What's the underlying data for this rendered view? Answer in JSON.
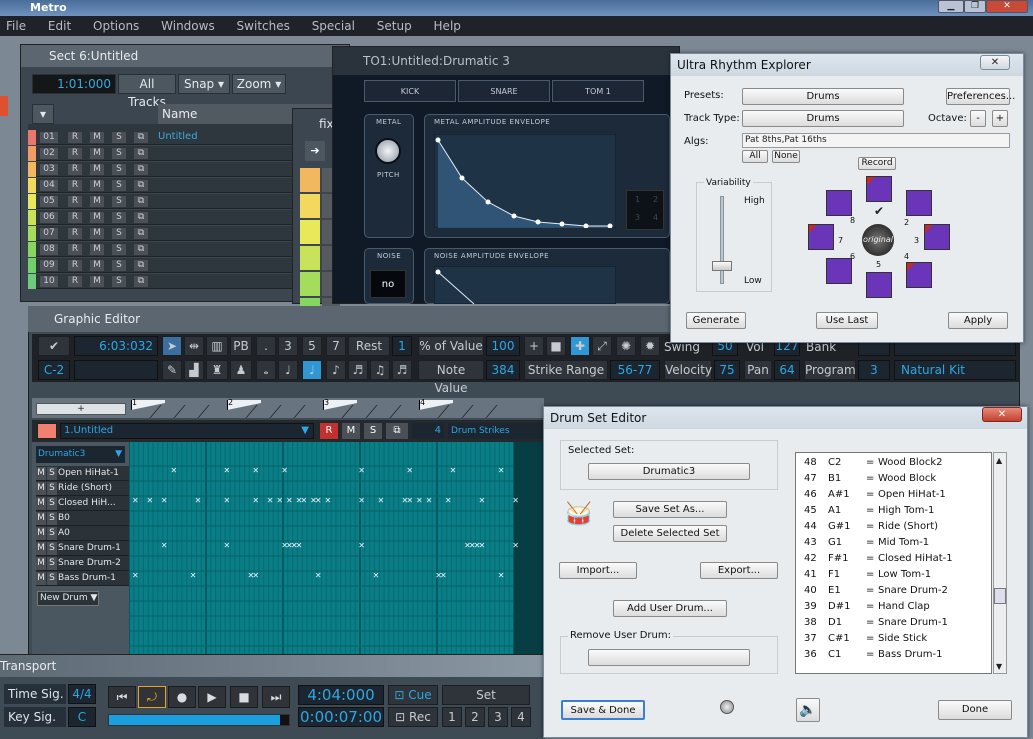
{
  "app": {
    "title": "Metro",
    "menu": [
      "File",
      "Edit",
      "Options",
      "Windows",
      "Switches",
      "Special",
      "Setup",
      "Help"
    ]
  },
  "sect": {
    "title": "Sect 6:Untitled",
    "time": "1:01:000",
    "all_tracks": "All Tracks",
    "snap": "Snap",
    "zoom": "Zoom",
    "name_header": "Name",
    "tracks": [
      {
        "num": "01",
        "name": "Untitled"
      },
      {
        "num": "02"
      },
      {
        "num": "03"
      },
      {
        "num": "04"
      },
      {
        "num": "05"
      },
      {
        "num": "06"
      },
      {
        "num": "07"
      },
      {
        "num": "08"
      },
      {
        "num": "09"
      },
      {
        "num": "10"
      }
    ],
    "track_colors": [
      "#e8786e",
      "#f09c62",
      "#f2b860",
      "#f2d85e",
      "#e8e85a",
      "#c8e25a",
      "#a6dc5c",
      "#86d660",
      "#70d06a",
      "#6ccc7c"
    ]
  },
  "fix": {
    "title": "fix"
  },
  "drumatic": {
    "title": "TO1:Untitled:Drumatic 3",
    "tabs": [
      "KICK",
      "SNARE",
      "TOM 1"
    ],
    "metal": "METAL",
    "metal_env": "METAL AMPLITUDE ENVELOPE",
    "pitch": "PITCH",
    "noise": "NOISE",
    "noise_env": "NOISE AMPLITUDE ENVELOPE",
    "noise_val": "no",
    "pads": [
      "1",
      "2",
      "3",
      "4"
    ]
  },
  "graphic_editor": {
    "title": "Graphic Editor",
    "position": "6:03:032",
    "note": "C-2",
    "tools": {
      "pb": "PB",
      "dot": ".",
      "n3": "3",
      "n5": "5",
      "n7": "7",
      "rest": "Rest",
      "rest_val": "1"
    },
    "pct_of_value": {
      "label": "% of Value",
      "value": "100"
    },
    "note_value": {
      "label": "Note Value",
      "value": "384"
    },
    "strike_range": {
      "label": "Strike Range",
      "value": "56-77"
    },
    "swing": {
      "label": "Swing",
      "value": "50"
    },
    "vol": {
      "label": "Vol",
      "value": "127"
    },
    "bank": {
      "label": "Bank"
    },
    "velocity": {
      "label": "Velocity",
      "value": "75"
    },
    "pan": {
      "label": "Pan",
      "value": "64"
    },
    "program": {
      "label": "Program",
      "value": "3"
    },
    "kit": "Natural Kit",
    "ruler": [
      "1",
      "2",
      "3",
      "4"
    ],
    "track": {
      "name": "1.Untitled",
      "r": "R",
      "m": "M",
      "s": "S",
      "channel": "4",
      "output": "Drum Strikes"
    },
    "instrument": "Drumatic3",
    "new_drum": "New Drum",
    "drums": [
      {
        "name": "Open HiHat-1",
        "hits": [
          8,
          19,
          25,
          31,
          47,
          57,
          66,
          76
        ]
      },
      {
        "name": "Ride (Short)",
        "hits": []
      },
      {
        "name": "Closed HiH...",
        "hits": [
          0,
          3,
          6,
          13,
          19,
          25,
          28,
          30,
          32,
          34,
          35,
          37,
          38,
          40,
          47,
          51,
          56,
          57,
          59,
          61,
          65,
          72,
          79
        ]
      },
      {
        "name": "B0",
        "hits": []
      },
      {
        "name": "A0",
        "hits": []
      },
      {
        "name": "Snare Drum-1",
        "hits": [
          6,
          19,
          31,
          32,
          33,
          34,
          47,
          69,
          70,
          71,
          72,
          79
        ]
      },
      {
        "name": "Snare Drum-2",
        "hits": []
      },
      {
        "name": "Bass Drum-1",
        "hits": [
          0,
          12,
          24,
          25,
          38,
          50,
          63,
          64,
          76
        ]
      }
    ]
  },
  "transport": {
    "title": "Transport",
    "time_sig_label": "Time Sig.",
    "time_sig": "4/4",
    "key_sig_label": "Key Sig.",
    "key_sig": "C",
    "position": "4:04:000",
    "clock": "0:00:07:00",
    "cue": "Cue",
    "rec": "Rec",
    "set": "Set",
    "locators": [
      "1",
      "2",
      "3",
      "4"
    ]
  },
  "rhythm": {
    "title": "Ultra Rhythm Explorer",
    "presets_label": "Presets:",
    "presets": "Drums",
    "preferences": "Preferences...",
    "track_type_label": "Track Type:",
    "track_type": "Drums",
    "octave_label": "Octave:",
    "minus": "-",
    "plus": "+",
    "algs_label": "Algs:",
    "algs": "Pat 8ths,Pat 16ths",
    "all": "All",
    "none": "None",
    "record": "Record",
    "variability": "Variability",
    "high": "High",
    "low": "Low",
    "original": "original",
    "pad_numbers": [
      "1",
      "2",
      "3",
      "4",
      "5",
      "6",
      "7",
      "8"
    ],
    "generate": "Generate",
    "use_last": "Use Last",
    "apply": "Apply"
  },
  "drumset": {
    "title": "Drum Set Editor",
    "selected_set_label": "Selected Set:",
    "selected_set": "Drumatic3",
    "save_set_as": "Save Set As...",
    "delete_set": "Delete Selected Set",
    "import": "Import...",
    "export": "Export...",
    "add_user_drum": "Add User Drum...",
    "remove_label": "Remove User Drum:",
    "save_done": "Save & Done",
    "done": "Done",
    "list": [
      {
        "num": "48",
        "note": "C2",
        "name": "Wood Block2"
      },
      {
        "num": "47",
        "note": "B1",
        "name": "Wood Block"
      },
      {
        "num": "46",
        "note": "A#1",
        "name": "Open HiHat-1"
      },
      {
        "num": "45",
        "note": "A1",
        "name": "High Tom-1"
      },
      {
        "num": "44",
        "note": "G#1",
        "name": "Ride (Short)"
      },
      {
        "num": "43",
        "note": "G1",
        "name": "Mid Tom-1"
      },
      {
        "num": "42",
        "note": "F#1",
        "name": "Closed HiHat-1"
      },
      {
        "num": "41",
        "note": "F1",
        "name": "Low Tom-1"
      },
      {
        "num": "40",
        "note": "E1",
        "name": "Snare Drum-2"
      },
      {
        "num": "39",
        "note": "D#1",
        "name": "Hand Clap"
      },
      {
        "num": "38",
        "note": "D1",
        "name": "Snare Drum-1"
      },
      {
        "num": "37",
        "note": "C#1",
        "name": "Side Stick"
      },
      {
        "num": "36",
        "note": "C1",
        "name": "Bass Drum-1"
      }
    ]
  }
}
